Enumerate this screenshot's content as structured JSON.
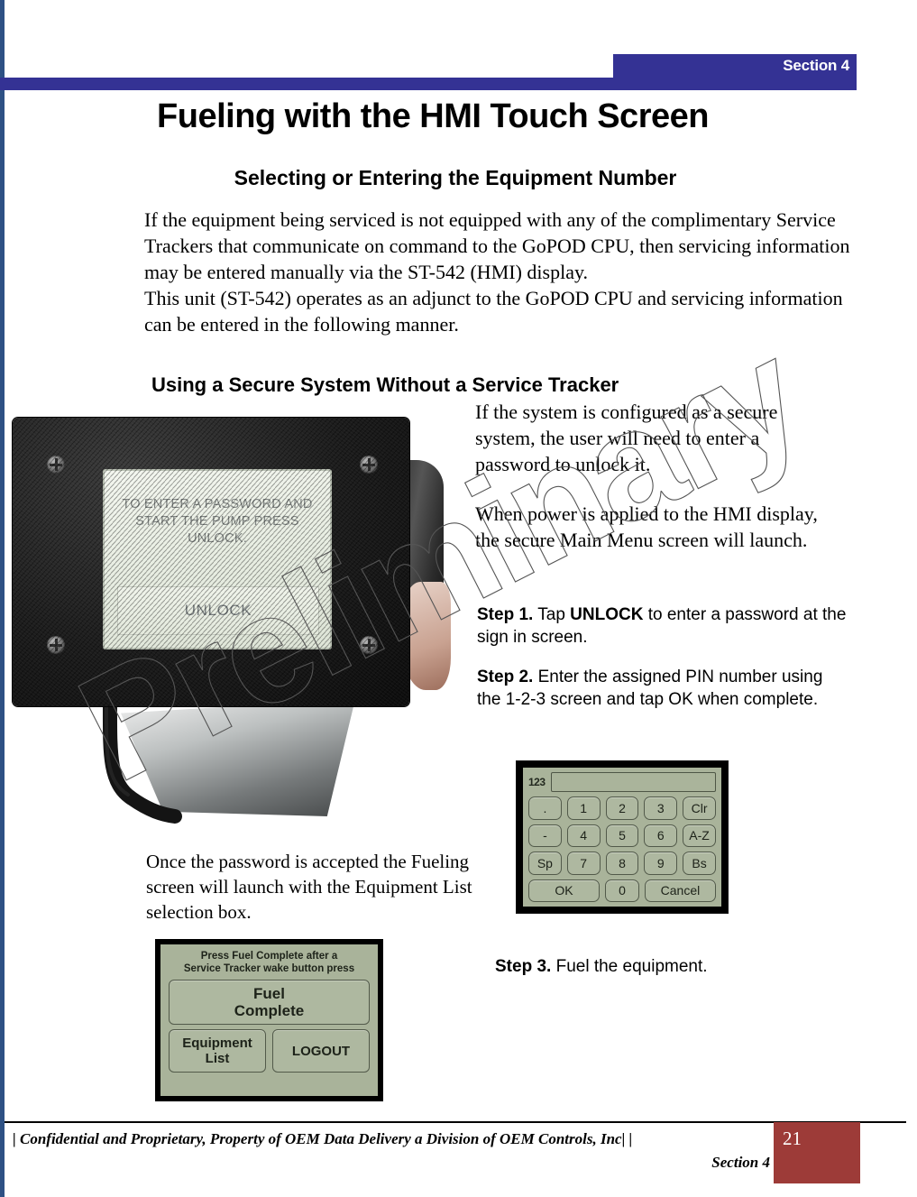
{
  "header": {
    "section_tab": "Section 4"
  },
  "title": "Fueling with the HMI Touch Screen",
  "headings": {
    "h1": "Selecting or Entering the Equipment Number",
    "h2": "Using a Secure System Without a Service Tracker"
  },
  "intro": {
    "p1": "If the equipment being serviced is not equipped with any of the complimentary Service Trackers that communicate on command to the GoPOD CPU, then servicing information may be entered manually via the ST-542 (HMI) display.",
    "p2": "This unit (ST-542) operates as an adjunct to the GoPOD CPU and servicing information can be entered in the following manner."
  },
  "right_column": {
    "p1": "If the system is configured as a secure system, the user will need to enter a password to unlock it.",
    "p2": "When power is applied to the HMI display, the secure Main Menu screen will launch."
  },
  "steps": {
    "step1_label": "Step 1.",
    "step1_pre": " Tap ",
    "step1_bold": "UNLOCK",
    "step1_post": " to enter a password at the sign in screen.",
    "step2_label": "Step 2.",
    "step2_text": " Enter the assigned PIN number using the 1-2-3 screen and tap OK when complete.",
    "step3_label": "Step 3.",
    "step3_text": " Fuel the equipment."
  },
  "once_text": "Once the password  is accepted  the Fueling screen will launch with the Equipment List selection box.",
  "hmi_photo": {
    "lcd_message": "TO ENTER A PASSWORD AND\nSTART THE PUMP PRESS\nUNLOCK.",
    "lcd_button": "UNLOCK"
  },
  "keypad": {
    "mode": "123",
    "display_value": "",
    "rows": [
      [
        ".",
        "1",
        "2",
        "3",
        "Clr"
      ],
      [
        "-",
        "4",
        "5",
        "6",
        "A-Z"
      ],
      [
        "Sp",
        "7",
        "8",
        "9",
        "Bs"
      ]
    ],
    "bottom_row": [
      "OK",
      "0",
      "Cancel"
    ]
  },
  "fuel_screen": {
    "note": "Press Fuel Complete after a\nService Tracker wake button press",
    "primary_button": "Fuel\nComplete",
    "secondary_buttons": [
      "Equipment\nList",
      "LOGOUT"
    ]
  },
  "watermark": {
    "text": "Preliminary"
  },
  "footer": {
    "line1": "| Confidential and Proprietary, Property of OEM Data Delivery a Division of OEM Controls, Inc| |",
    "line2": "Section 4",
    "page_number": "21"
  },
  "colors": {
    "header_blue": "#343294",
    "left_rule_blue": "#2e5184",
    "page_box_red": "#9d3b38",
    "lcd_green": "#a9b39a"
  }
}
